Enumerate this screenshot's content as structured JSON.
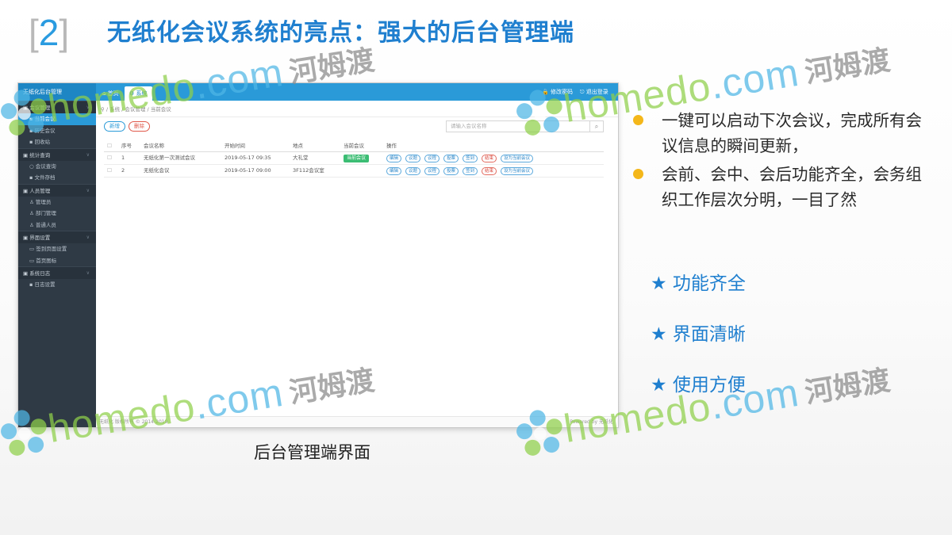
{
  "slide": {
    "number": "2",
    "bracket_open": "[",
    "bracket_close": "]",
    "title": "无纸化会议系统的亮点：强大的后台管理端",
    "caption": "后台管理端界面",
    "bullets": [
      "一键可以启动下次会议，完成所有会议信息的瞬间更新，",
      "会前、会中、会后功能齐全，会务组织工作层次分明，一目了然"
    ],
    "features": [
      "★ 功能齐全",
      "★ 界面清晰",
      "★ 使用方便"
    ],
    "colors": {
      "title": "#1f7fcf",
      "bullet_dot": "#f4b71a",
      "feature": "#1f7fcf"
    }
  },
  "admin": {
    "brand": "无纸化后台管理",
    "top_tabs": [
      "首页",
      "系统"
    ],
    "top_right": [
      "修改密码",
      "退出登录"
    ],
    "sidebar": [
      {
        "group": "会议管理",
        "items": [
          "当前会议",
          "历史会议",
          "回收站"
        ]
      },
      {
        "group": "统计查询",
        "items": [
          "会议查询",
          "文件存档"
        ]
      },
      {
        "group": "人员管理",
        "items": [
          "管理员",
          "部门管理",
          "普通人员"
        ]
      },
      {
        "group": "界面设置",
        "items": [
          "签到页面设置",
          "首页图标"
        ]
      },
      {
        "group": "系统日志",
        "items": [
          "日志设置"
        ]
      }
    ],
    "active_item": "当前会议",
    "breadcrumb": [
      "系统",
      "会议管理",
      "当前会议"
    ],
    "buttons": {
      "add": "新增",
      "delete": "删除"
    },
    "search_placeholder": "请输入会议名称",
    "columns": [
      "序号",
      "会议名称",
      "开始时间",
      "地点",
      "当前会议",
      "操作"
    ],
    "rows": [
      {
        "no": "1",
        "name": "无纸化第一次测试会议",
        "start": "2019-05-17 09:35",
        "place": "大礼堂",
        "current": "当前会议",
        "ops": [
          "编辑",
          "议题",
          "议程",
          "投票",
          "签到",
          "结束",
          "设为当前会议"
        ]
      },
      {
        "no": "2",
        "name": "无纸化会议",
        "start": "2019-05-17 09:00",
        "place": "3F112会议室",
        "current": "",
        "ops": [
          "编辑",
          "议题",
          "议程",
          "投票",
          "签到",
          "结束",
          "设为当前会议"
        ]
      }
    ],
    "footer_left": "无纸化 版权所有 © 2014-2019",
    "footer_right": "Powered by 无纸化"
  },
  "watermark": {
    "en": "homedo",
    "dot": ".com",
    "cn": "河姆渡"
  }
}
